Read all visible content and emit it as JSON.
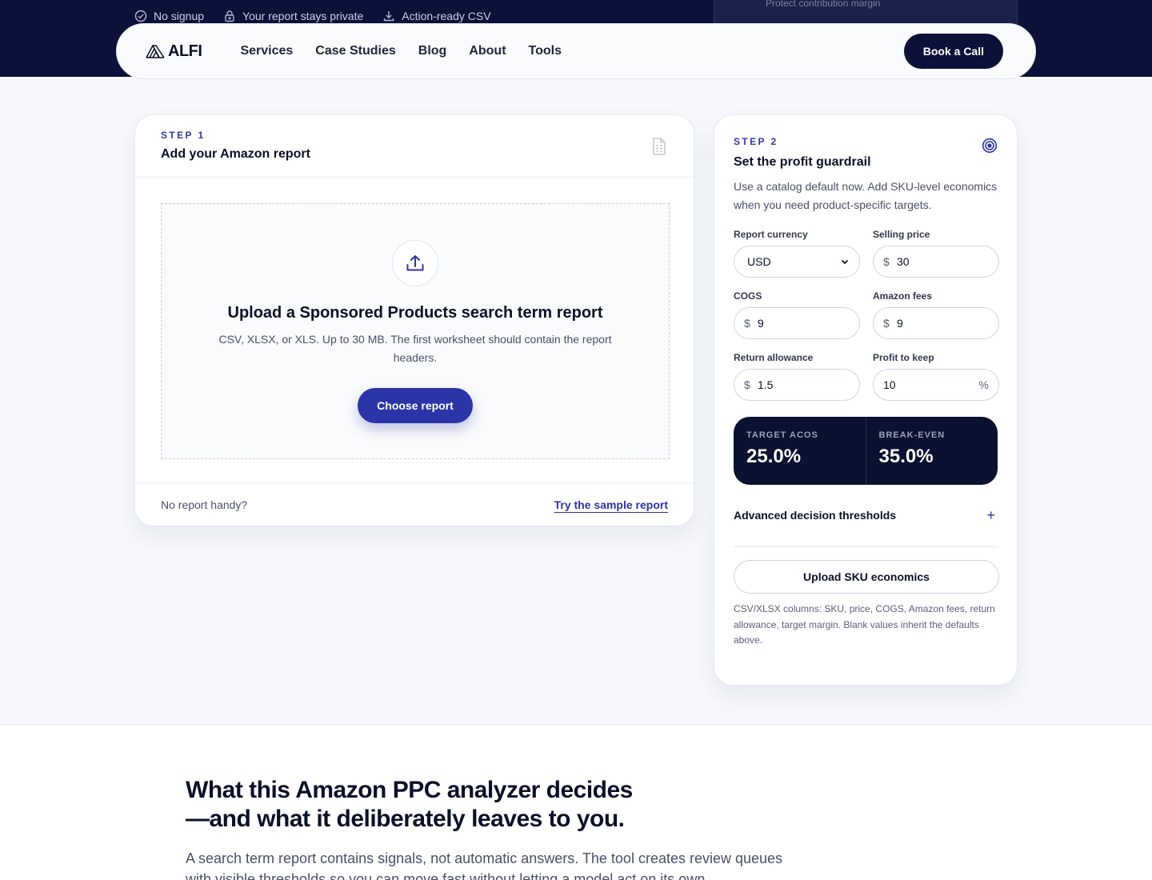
{
  "trust": [
    {
      "icon": "check-circle-icon",
      "label": "No signup"
    },
    {
      "icon": "lock-icon",
      "label": "Your report stays private"
    },
    {
      "icon": "download-icon",
      "label": "Action-ready CSV"
    }
  ],
  "peek_text": "Protect contribution margin",
  "nav": {
    "logo": "ALFI",
    "items": [
      "Services",
      "Case Studies",
      "Blog",
      "About",
      "Tools"
    ],
    "cta": "Book a Call"
  },
  "step1": {
    "step": "STEP 1",
    "title": "Add your Amazon report",
    "drop_title": "Upload a Sponsored Products search term report",
    "drop_desc": "CSV, XLSX, or XLS. Up to 30 MB. The first worksheet should contain the report headers.",
    "choose": "Choose report",
    "foot_text": "No report handy?",
    "foot_link": "Try the sample report"
  },
  "step2": {
    "step": "STEP 2",
    "title": "Set the profit guardrail",
    "desc": "Use a catalog default now. Add SKU-level economics when you need product-specific targets.",
    "fields": {
      "currency": {
        "label": "Report currency",
        "value": "USD"
      },
      "price": {
        "label": "Selling price",
        "prefix": "$",
        "value": "30"
      },
      "cogs": {
        "label": "COGS",
        "prefix": "$",
        "value": "9"
      },
      "fees": {
        "label": "Amazon fees",
        "prefix": "$",
        "value": "9"
      },
      "returns": {
        "label": "Return allowance",
        "prefix": "$",
        "value": "1.5"
      },
      "profit": {
        "label": "Profit to keep",
        "value": "10",
        "suffix": "%"
      }
    },
    "metrics": {
      "target_label": "TARGET ACOS",
      "target_value": "25.0%",
      "breakeven_label": "BREAK-EVEN",
      "breakeven_value": "35.0%"
    },
    "advanced": "Advanced decision thresholds",
    "advanced_toggle": "+",
    "sku_button": "Upload SKU economics",
    "sku_note": "CSV/XLSX columns: SKU, price, COGS, Amazon fees, return allowance, target margin. Blank values inherit the defaults above."
  },
  "section": {
    "heading_line1": "What this Amazon PPC analyzer decides",
    "heading_line2": "—and what it deliberately leaves to you.",
    "lead": "A search term report contains signals, not automatic answers. The tool creates review queues with visible thresholds so you can move fast without letting a model act on its own."
  },
  "colors": {
    "navy": "#0b1138",
    "accent": "#2b35a8"
  }
}
